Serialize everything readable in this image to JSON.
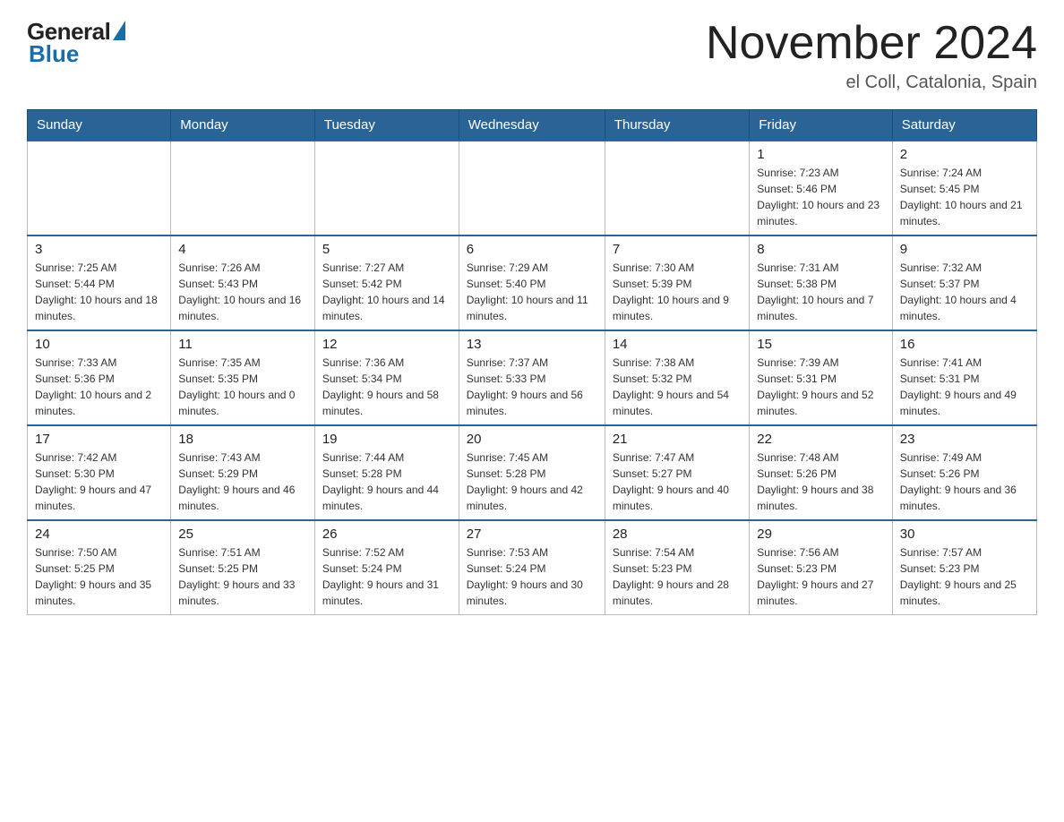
{
  "header": {
    "logo_general": "General",
    "logo_blue": "Blue",
    "month_title": "November 2024",
    "location": "el Coll, Catalonia, Spain"
  },
  "days_of_week": [
    "Sunday",
    "Monday",
    "Tuesday",
    "Wednesday",
    "Thursday",
    "Friday",
    "Saturday"
  ],
  "weeks": [
    [
      {
        "day": "",
        "info": ""
      },
      {
        "day": "",
        "info": ""
      },
      {
        "day": "",
        "info": ""
      },
      {
        "day": "",
        "info": ""
      },
      {
        "day": "",
        "info": ""
      },
      {
        "day": "1",
        "info": "Sunrise: 7:23 AM\nSunset: 5:46 PM\nDaylight: 10 hours and 23 minutes."
      },
      {
        "day": "2",
        "info": "Sunrise: 7:24 AM\nSunset: 5:45 PM\nDaylight: 10 hours and 21 minutes."
      }
    ],
    [
      {
        "day": "3",
        "info": "Sunrise: 7:25 AM\nSunset: 5:44 PM\nDaylight: 10 hours and 18 minutes."
      },
      {
        "day": "4",
        "info": "Sunrise: 7:26 AM\nSunset: 5:43 PM\nDaylight: 10 hours and 16 minutes."
      },
      {
        "day": "5",
        "info": "Sunrise: 7:27 AM\nSunset: 5:42 PM\nDaylight: 10 hours and 14 minutes."
      },
      {
        "day": "6",
        "info": "Sunrise: 7:29 AM\nSunset: 5:40 PM\nDaylight: 10 hours and 11 minutes."
      },
      {
        "day": "7",
        "info": "Sunrise: 7:30 AM\nSunset: 5:39 PM\nDaylight: 10 hours and 9 minutes."
      },
      {
        "day": "8",
        "info": "Sunrise: 7:31 AM\nSunset: 5:38 PM\nDaylight: 10 hours and 7 minutes."
      },
      {
        "day": "9",
        "info": "Sunrise: 7:32 AM\nSunset: 5:37 PM\nDaylight: 10 hours and 4 minutes."
      }
    ],
    [
      {
        "day": "10",
        "info": "Sunrise: 7:33 AM\nSunset: 5:36 PM\nDaylight: 10 hours and 2 minutes."
      },
      {
        "day": "11",
        "info": "Sunrise: 7:35 AM\nSunset: 5:35 PM\nDaylight: 10 hours and 0 minutes."
      },
      {
        "day": "12",
        "info": "Sunrise: 7:36 AM\nSunset: 5:34 PM\nDaylight: 9 hours and 58 minutes."
      },
      {
        "day": "13",
        "info": "Sunrise: 7:37 AM\nSunset: 5:33 PM\nDaylight: 9 hours and 56 minutes."
      },
      {
        "day": "14",
        "info": "Sunrise: 7:38 AM\nSunset: 5:32 PM\nDaylight: 9 hours and 54 minutes."
      },
      {
        "day": "15",
        "info": "Sunrise: 7:39 AM\nSunset: 5:31 PM\nDaylight: 9 hours and 52 minutes."
      },
      {
        "day": "16",
        "info": "Sunrise: 7:41 AM\nSunset: 5:31 PM\nDaylight: 9 hours and 49 minutes."
      }
    ],
    [
      {
        "day": "17",
        "info": "Sunrise: 7:42 AM\nSunset: 5:30 PM\nDaylight: 9 hours and 47 minutes."
      },
      {
        "day": "18",
        "info": "Sunrise: 7:43 AM\nSunset: 5:29 PM\nDaylight: 9 hours and 46 minutes."
      },
      {
        "day": "19",
        "info": "Sunrise: 7:44 AM\nSunset: 5:28 PM\nDaylight: 9 hours and 44 minutes."
      },
      {
        "day": "20",
        "info": "Sunrise: 7:45 AM\nSunset: 5:28 PM\nDaylight: 9 hours and 42 minutes."
      },
      {
        "day": "21",
        "info": "Sunrise: 7:47 AM\nSunset: 5:27 PM\nDaylight: 9 hours and 40 minutes."
      },
      {
        "day": "22",
        "info": "Sunrise: 7:48 AM\nSunset: 5:26 PM\nDaylight: 9 hours and 38 minutes."
      },
      {
        "day": "23",
        "info": "Sunrise: 7:49 AM\nSunset: 5:26 PM\nDaylight: 9 hours and 36 minutes."
      }
    ],
    [
      {
        "day": "24",
        "info": "Sunrise: 7:50 AM\nSunset: 5:25 PM\nDaylight: 9 hours and 35 minutes."
      },
      {
        "day": "25",
        "info": "Sunrise: 7:51 AM\nSunset: 5:25 PM\nDaylight: 9 hours and 33 minutes."
      },
      {
        "day": "26",
        "info": "Sunrise: 7:52 AM\nSunset: 5:24 PM\nDaylight: 9 hours and 31 minutes."
      },
      {
        "day": "27",
        "info": "Sunrise: 7:53 AM\nSunset: 5:24 PM\nDaylight: 9 hours and 30 minutes."
      },
      {
        "day": "28",
        "info": "Sunrise: 7:54 AM\nSunset: 5:23 PM\nDaylight: 9 hours and 28 minutes."
      },
      {
        "day": "29",
        "info": "Sunrise: 7:56 AM\nSunset: 5:23 PM\nDaylight: 9 hours and 27 minutes."
      },
      {
        "day": "30",
        "info": "Sunrise: 7:57 AM\nSunset: 5:23 PM\nDaylight: 9 hours and 25 minutes."
      }
    ]
  ]
}
